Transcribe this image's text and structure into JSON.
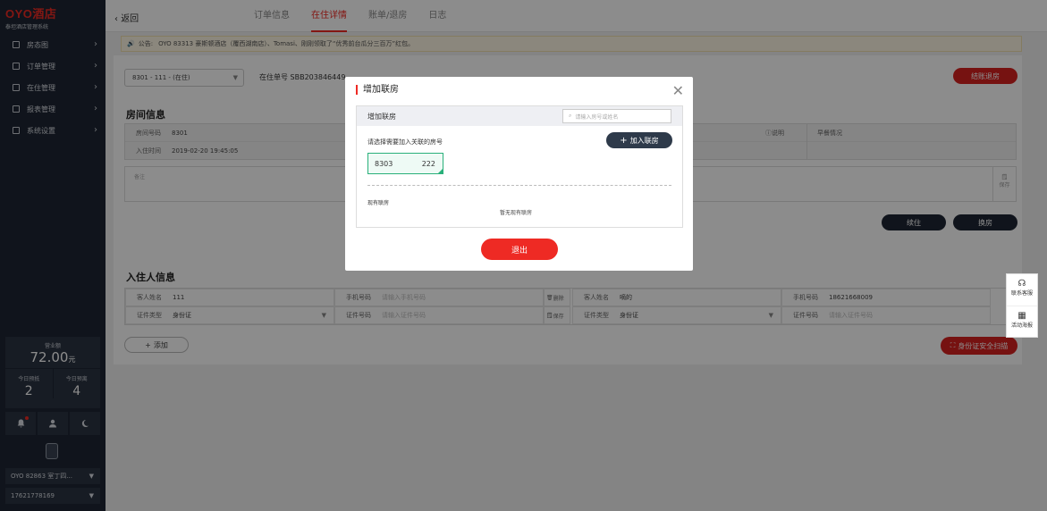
{
  "sidebar": {
    "brand": "OYO酒店",
    "subtitle": "泰坦酒店管理系统",
    "menu": [
      {
        "label": "房态图"
      },
      {
        "label": "订单管理"
      },
      {
        "label": "在住管理"
      },
      {
        "label": "报表管理"
      },
      {
        "label": "系统设置"
      }
    ],
    "revenue_label": "营业额",
    "revenue_value": "72.00",
    "revenue_unit": "元",
    "today_checkin_label": "今日预抵",
    "today_checkin_value": "2",
    "today_checkout_label": "今日预离",
    "today_checkout_value": "4",
    "hotel_select": "OYO 82863 室丁四...",
    "phone_select": "17621778169"
  },
  "topbar": {
    "back_label": "返回",
    "tabs": [
      {
        "label": "订单信息"
      },
      {
        "label": "在住详情",
        "active": true
      },
      {
        "label": "账单/退房"
      },
      {
        "label": "日志"
      }
    ]
  },
  "notice": {
    "prefix": "公告:",
    "text": "OYO 83313 豪斯顿酒店（覆西湖南店）、Tomasi、刚刚领取了“优秀前台瓜分三百万”红包。"
  },
  "main": {
    "room_select": "8301 - 111 - (在住)",
    "order_no": "在住单号  SBB203846449",
    "checkout_button": "结账退房",
    "room_section_title": "房间信息",
    "room_fields": {
      "room_no_label": "房间号码",
      "room_no_value": "8301",
      "checkin_label": "入住时间",
      "checkin_value": "2019-02-20 19:45:05",
      "explain_label": "说明",
      "breakfast_label": "早餐情况"
    },
    "remark_label": "备注",
    "save_label": "保存",
    "continue_button": "续住",
    "change_button": "换房",
    "guest_section_title": "入住人信息",
    "guests": [
      {
        "name_label": "客人姓名",
        "name_value": "111",
        "phone_label": "手机号码",
        "phone_placeholder": "请输入手机号码",
        "id_type_label": "证件类型",
        "id_type_value": "身份证",
        "id_no_label": "证件号码",
        "id_no_placeholder": "请输入证件号码",
        "delete_label": "删除",
        "save_label": "保存"
      },
      {
        "name_label": "客人姓名",
        "name_value": "嘀的",
        "phone_label": "手机号码",
        "phone_value": "18621668009",
        "id_type_label": "证件类型",
        "id_type_value": "身份证",
        "id_no_label": "证件号码",
        "id_no_placeholder": "请输入证件号码"
      }
    ],
    "add_button": "添加",
    "id_scan_button": "身份证安全扫描"
  },
  "float": {
    "service_label": "联系客服",
    "poster_label": "活动海报"
  },
  "modal": {
    "title": "增加联房",
    "inner_title": "增加联房",
    "search_placeholder": "请输入房号或姓名",
    "prompt": "请选择需要加入关联的房号",
    "join_button": "加入联房",
    "chip_room": "8303",
    "chip_number": "222",
    "existing_label": "现有联房",
    "none_label": "暂无现有联房",
    "exit_button": "退出"
  }
}
